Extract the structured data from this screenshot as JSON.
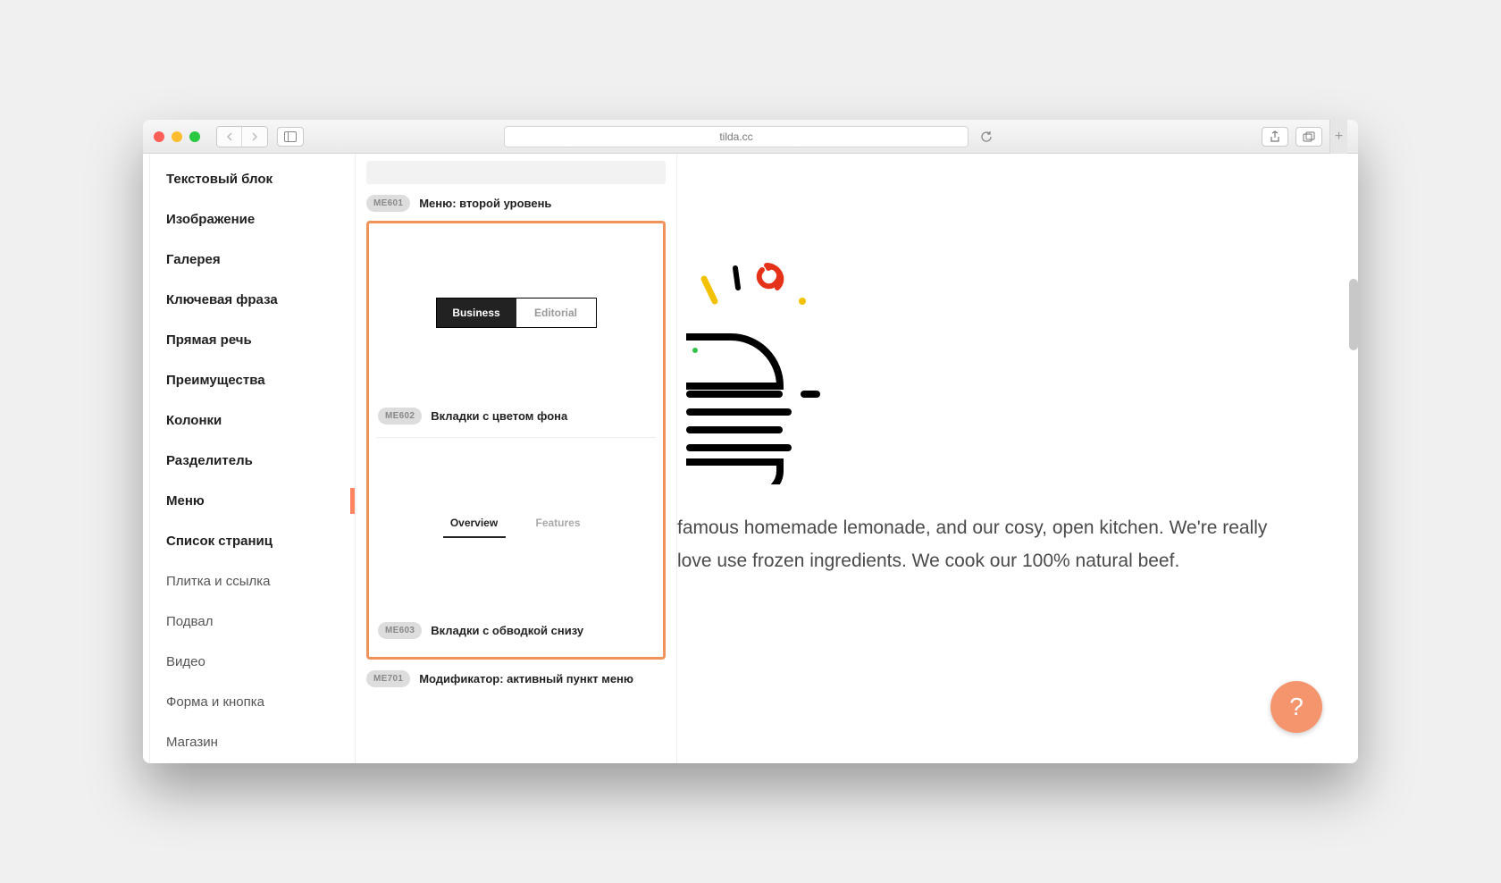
{
  "browser": {
    "url": "tilda.cc"
  },
  "sidebar": {
    "items": [
      {
        "label": "Текстовый блок",
        "weight": "bold",
        "active": false
      },
      {
        "label": "Изображение",
        "weight": "bold",
        "active": false
      },
      {
        "label": "Галерея",
        "weight": "bold",
        "active": false
      },
      {
        "label": "Ключевая фраза",
        "weight": "bold",
        "active": false
      },
      {
        "label": "Прямая речь",
        "weight": "bold",
        "active": false
      },
      {
        "label": "Преимущества",
        "weight": "bold",
        "active": false
      },
      {
        "label": "Колонки",
        "weight": "bold",
        "active": false
      },
      {
        "label": "Разделитель",
        "weight": "bold",
        "active": false
      },
      {
        "label": "Меню",
        "weight": "bold",
        "active": true
      },
      {
        "label": "Список страниц",
        "weight": "bold",
        "active": false
      },
      {
        "label": "Плитка и ссылка",
        "weight": "light",
        "active": false
      },
      {
        "label": "Подвал",
        "weight": "light",
        "active": false
      },
      {
        "label": "Видео",
        "weight": "light",
        "active": false
      },
      {
        "label": "Форма и кнопка",
        "weight": "light",
        "active": false
      },
      {
        "label": "Магазин",
        "weight": "light",
        "active": false
      }
    ]
  },
  "blocks": {
    "me601": {
      "code": "ME601",
      "title": "Меню: второй уровень"
    },
    "me602": {
      "code": "ME602",
      "title": "Вкладки с цветом фона",
      "tabs": [
        "Business",
        "Editorial"
      ]
    },
    "me603": {
      "code": "ME603",
      "title": "Вкладки с обводкой снизу",
      "tabs": [
        "Overview",
        "Features"
      ]
    },
    "me701": {
      "code": "ME701",
      "title": "Модификатор: активный пункт меню"
    }
  },
  "page": {
    "paragraph": " famous homemade lemonade, and our cosy, open kitchen. We're really love use frozen ingredients. We cook our 100% natural beef."
  },
  "help": {
    "label": "?"
  }
}
